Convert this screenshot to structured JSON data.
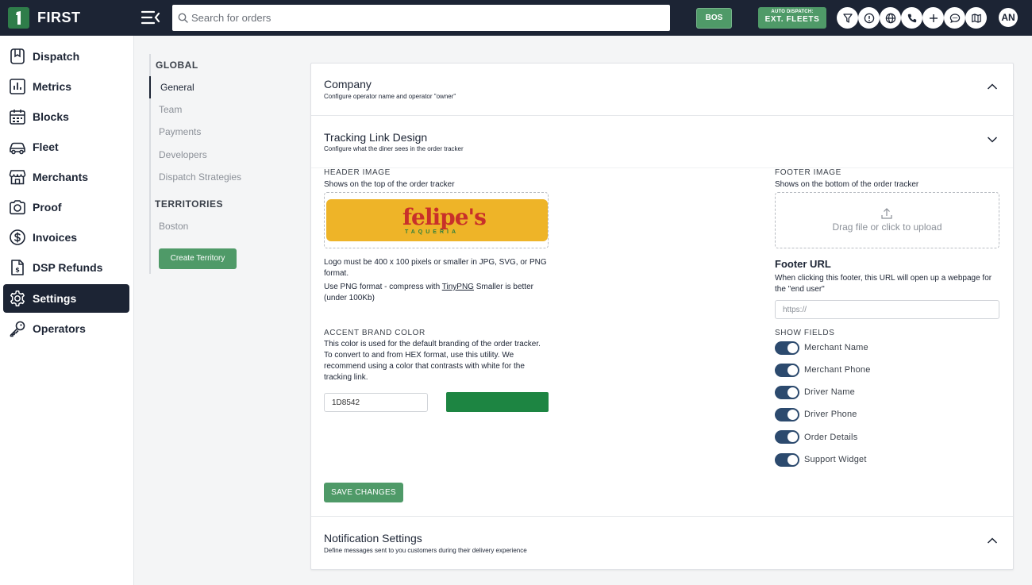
{
  "app": {
    "name": "FIRST"
  },
  "topbar": {
    "search_placeholder": "Search for orders",
    "bos_label": "BOS",
    "dispatch_line1": "AUTO DISPATCH:",
    "dispatch_line2": "EXT. FLEETS",
    "icons": [
      "filter-icon",
      "info-icon",
      "globe-icon",
      "phone-icon",
      "plus-icon",
      "chat-icon",
      "map-icon"
    ],
    "avatar_initials": "AN"
  },
  "sidebar": {
    "items": [
      {
        "label": "Dispatch",
        "icon": "dispatch-icon"
      },
      {
        "label": "Metrics",
        "icon": "metrics-icon"
      },
      {
        "label": "Blocks",
        "icon": "calendar-icon"
      },
      {
        "label": "Fleet",
        "icon": "car-icon"
      },
      {
        "label": "Merchants",
        "icon": "store-icon"
      },
      {
        "label": "Proof",
        "icon": "camera-icon"
      },
      {
        "label": "Invoices",
        "icon": "dollar-icon"
      },
      {
        "label": "DSP Refunds",
        "icon": "refund-icon"
      },
      {
        "label": "Settings",
        "icon": "gear-icon",
        "active": true
      },
      {
        "label": "Operators",
        "icon": "key-icon"
      }
    ]
  },
  "settings_nav": {
    "global_heading": "GLOBAL",
    "global_items": [
      "General",
      "Team",
      "Payments",
      "Developers",
      "Dispatch Strategies"
    ],
    "territories_heading": "TERRITORIES",
    "territory_items": [
      "Boston"
    ],
    "create_territory_label": "Create Territory"
  },
  "company": {
    "title": "Company",
    "subtitle": "Configure operator name and operator \"owner\""
  },
  "tracking": {
    "title": "Tracking Link Design",
    "subtitle": "Configure what the diner sees in the order tracker",
    "header_image_label": "HEADER IMAGE",
    "header_image_desc": "Shows on the top of the order tracker",
    "logo_text": "felipe's",
    "logo_subtext": "TAQUERIA",
    "logo_note_1": "Logo must be 400 x 100 pixels or smaller in JPG, SVG, or PNG format.",
    "logo_note_2_prefix": "Use PNG format - compress with ",
    "logo_note_2_link": "TinyPNG",
    "logo_note_2_suffix": " Smaller is better (under 100Kb)",
    "accent_label": "ACCENT BRAND COLOR",
    "accent_desc": "This color is used for the default branding of the order tracker. To convert to and from HEX format, use this utility. We recommend using a color that contrasts with white for the tracking link.",
    "accent_hex": "1D8542",
    "accent_color": "#1D8542",
    "footer_image_label": "FOOTER IMAGE",
    "footer_image_desc": "Shows on the bottom of the order tracker",
    "upload_text": "Drag file or click to upload",
    "footer_url_label": "Footer URL",
    "footer_url_desc": "When clicking this footer, this URL will open up a webpage for the \"end user\"",
    "footer_url_placeholder": "https://",
    "show_fields_label": "SHOW FIELDS",
    "show_fields": [
      "Merchant Name",
      "Merchant Phone",
      "Driver Name",
      "Driver Phone",
      "Order Details",
      "Support Widget"
    ],
    "save_label": "SAVE CHANGES"
  },
  "notifications": {
    "title": "Notification Settings",
    "subtitle": "Define messages sent to you customers during their delivery experience"
  }
}
